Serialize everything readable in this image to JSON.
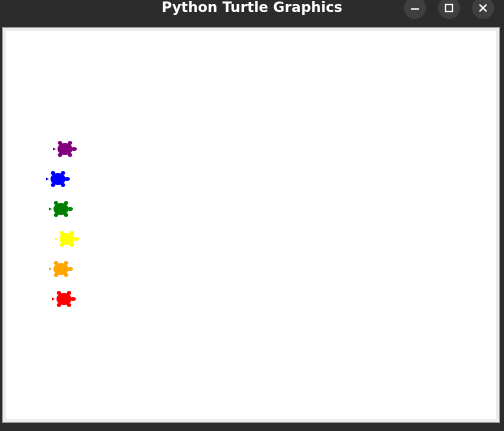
{
  "window": {
    "title": "Python Turtle Graphics",
    "buttons": [
      {
        "name": "minimize",
        "icon": "minimize-icon"
      },
      {
        "name": "maximize",
        "icon": "maximize-icon"
      },
      {
        "name": "close",
        "icon": "close-icon"
      }
    ]
  },
  "canvas": {
    "background": "#ffffff",
    "turtles": [
      {
        "name": "turtle-purple",
        "color": "#800080"
      },
      {
        "name": "turtle-blue",
        "color": "#0000ff"
      },
      {
        "name": "turtle-green",
        "color": "#008000"
      },
      {
        "name": "turtle-yellow",
        "color": "#ffff00"
      },
      {
        "name": "turtle-orange",
        "color": "#ffa500"
      },
      {
        "name": "turtle-red",
        "color": "#ff0000"
      }
    ]
  }
}
